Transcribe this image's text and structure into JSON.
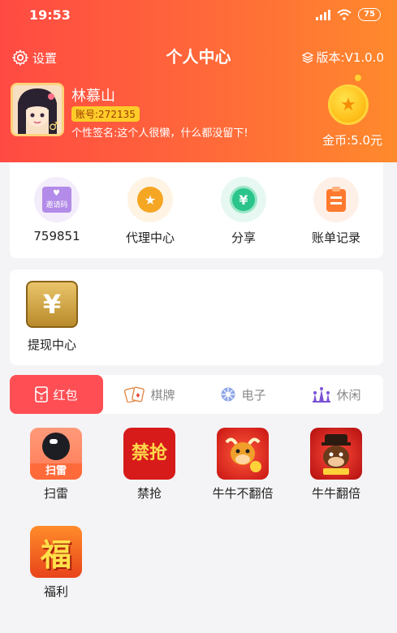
{
  "status": {
    "time": "19:53",
    "battery": "75"
  },
  "header": {
    "settings_label": "设置",
    "title": "个人中心",
    "version_label": "版本:V1.0.0"
  },
  "profile": {
    "name": "林慕山",
    "account": "账号:272135",
    "signature": "个性签名:这个人很懒，什么都没留下!",
    "gold": "金币:5.0元"
  },
  "quick_actions": [
    {
      "label": "759851",
      "icon": "invite-code-icon",
      "icon_text": "邀请码",
      "color": "#b38be8",
      "bg": "#f3ecfb"
    },
    {
      "label": "代理中心",
      "icon": "agent-medal-icon",
      "color": "#f5a623",
      "bg": "#fff3e3"
    },
    {
      "label": "分享",
      "icon": "share-yuan-icon",
      "color": "#2bc48a",
      "bg": "#e6f8f1"
    },
    {
      "label": "账单记录",
      "icon": "bill-icon",
      "color": "#ff7a2e",
      "bg": "#fff0e7"
    }
  ],
  "withdraw": {
    "label": "提现中心",
    "icon": "yuan-wallet-icon",
    "symbol": "¥"
  },
  "tabs": [
    {
      "label": "红包",
      "icon": "red-packet-icon",
      "active": true
    },
    {
      "label": "棋牌",
      "icon": "cards-icon",
      "active": false
    },
    {
      "label": "电子",
      "icon": "slot-wheel-icon",
      "active": false
    },
    {
      "label": "休闲",
      "icon": "chess-icon",
      "active": false
    }
  ],
  "games": [
    {
      "label": "扫雷",
      "icon": "minesweeper-game-icon",
      "badge": "扫雷"
    },
    {
      "label": "禁抢",
      "icon": "no-grab-game-icon",
      "badge": "禁抢"
    },
    {
      "label": "牛牛不翻倍",
      "icon": "bull-no-double-game-icon"
    },
    {
      "label": "牛牛翻倍",
      "icon": "bull-double-game-icon"
    },
    {
      "label": "福利",
      "icon": "welfare-game-icon",
      "badge": "福"
    }
  ],
  "colors": {
    "accent": "#ff4f55",
    "header_start": "#ff4a43",
    "header_end": "#ff8a2c"
  }
}
